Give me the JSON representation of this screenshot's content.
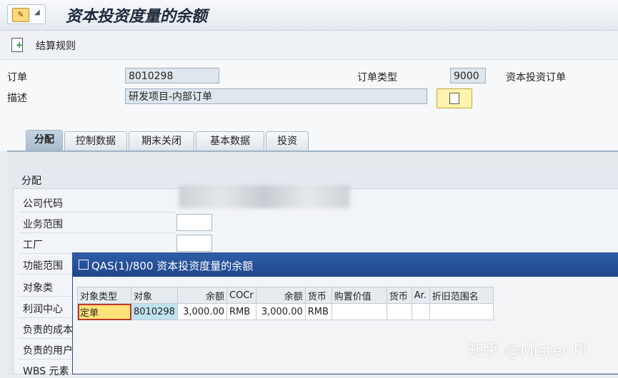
{
  "header": {
    "title": "资本投资度量的余额"
  },
  "toolbar": {
    "settlement_rule_label": "结算规则"
  },
  "order": {
    "order_label": "订单",
    "order_value": "8010298",
    "order_type_label": "订单类型",
    "order_type_value": "9000",
    "order_type_text": "资本投资订单",
    "description_label": "描述",
    "description_value": "研发项目-内部订单"
  },
  "tabs": [
    {
      "label": "分配",
      "active": true
    },
    {
      "label": "控制数据",
      "active": false
    },
    {
      "label": "期末关闭",
      "active": false
    },
    {
      "label": "基本数据",
      "active": false
    },
    {
      "label": "投资",
      "active": false
    }
  ],
  "assignment": {
    "group_title": "分配",
    "fields": [
      {
        "label": "公司代码"
      },
      {
        "label": "业务范围"
      },
      {
        "label": "工厂"
      },
      {
        "label": "功能范围"
      },
      {
        "label": "对象类"
      },
      {
        "label": "利润中心"
      },
      {
        "label": "负责的成本中心"
      },
      {
        "label": "负责的用户"
      },
      {
        "label": "WBS 元素"
      }
    ]
  },
  "dialog": {
    "title": "QAS(1)/800 资本投资度量的余额",
    "columns": [
      "对象类型",
      "对象",
      "余额",
      "COCr",
      "余额",
      "货币",
      "购置价值",
      "货币",
      "Ar.",
      "折旧范围名"
    ],
    "rows": [
      [
        "定单",
        "8010298",
        "3,000.00",
        "RMB",
        "3,000.00",
        "RMB",
        "",
        "",
        "",
        ""
      ]
    ]
  },
  "watermark": {
    "text": "知乎 @Mister Pi"
  },
  "colors": {
    "dialog_title_bg": "#2e5ea8",
    "accent_yellow": "#ffe27a",
    "selected_cell": "#bfe3ee"
  }
}
